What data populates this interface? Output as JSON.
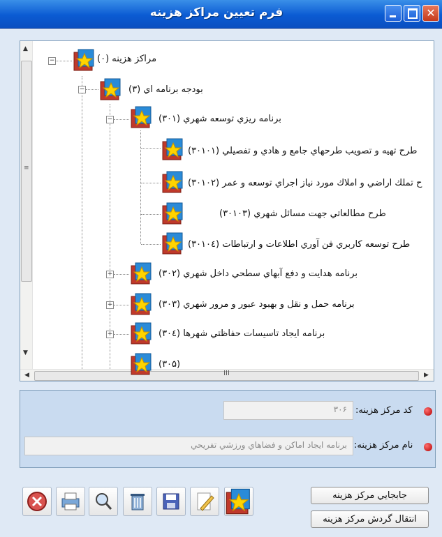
{
  "window": {
    "title": "فرم تعيين مراكز هزينه"
  },
  "tree": {
    "root": "مراكز هزينه (٠)",
    "budget": "بودجه برنامه اي (٣)",
    "program301": "برنامه ريزي توسعه شهري (٣٠١)",
    "items301": [
      "طرح تهيه و تصويب طرحهاي جامع و هادي و تفصيلي (٣٠١٠١)",
      "ح تملك اراضي و املاك مورد نياز اجراي توسعه و عمر (٣٠١٠٢)",
      "طرح مطالعاتي جهت مسائل شهري (٣٠١٠٣)",
      "طرح توسعه كاربري فن آوري اطلاعات و ارتباطات (٣٠١٠٤)"
    ],
    "program302": "برنامه هدايت و دفع آبهاي سطحي داخل شهري (٣٠٢)",
    "program303": "برنامه حمل و نقل و بهبود عبور و مرور شهري (٣٠٣)",
    "program304": "برنامه ايجاد تاسيسات حفاظتي شهرها (٣٠٤)",
    "program305_partial": "(٣٠۵)",
    "hscroll_grip": "III"
  },
  "form": {
    "code_label": "كد مركز هزينه:",
    "code_value": "٣٠۶",
    "name_label": "نام مركز هزينه:",
    "name_value": "برنامه ايجاد اماكن و فضاهاي ورزشي تفريحي"
  },
  "buttons": {
    "move": "جابجايي مركز هزينه",
    "transfer": "انتقال گردش مركز هزينه"
  },
  "icons": [
    "exit-icon",
    "print-icon",
    "search-icon",
    "delete-icon",
    "save-icon",
    "edit-icon",
    "new-folder-icon"
  ]
}
